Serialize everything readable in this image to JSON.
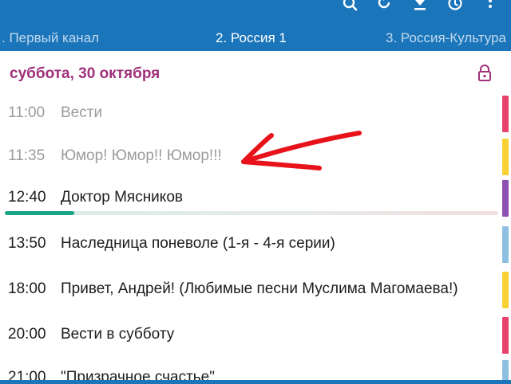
{
  "toolbar": {
    "icons": [
      "search-icon",
      "refresh-icon",
      "download-icon",
      "clock-icon",
      "more-vert-icon"
    ]
  },
  "tabs": [
    {
      "label": ". Первый канал"
    },
    {
      "label": "2. Россия 1"
    },
    {
      "label": "3. Россия-Культура"
    }
  ],
  "active_tab_index": 1,
  "schedule": {
    "date": "суббота, 30 октября",
    "lock_icon": "lock-icon",
    "now_progress": 0.14,
    "programs": [
      {
        "time": "11:00",
        "title": "Вести",
        "status": "past",
        "genre_color": "#e8436b"
      },
      {
        "time": "11:35",
        "title": "Юмор! Юмор!! Юмор!!!",
        "status": "past",
        "genre_color": "#f8d232"
      },
      {
        "time": "12:40",
        "title": "Доктор Мясников",
        "status": "now",
        "genre_color": "#8e4fb3"
      },
      {
        "time": "13:50",
        "title": "Наследница поневоле (1-я - 4-я серии)",
        "status": "future",
        "genre_color": "#8fbfe0"
      },
      {
        "time": "18:00",
        "title": "Привет, Андрей! (Любимые песни Муслима Магомаева!)",
        "status": "future",
        "genre_color": "#f8d232"
      },
      {
        "time": "20:00",
        "title": "Вести в субботу",
        "status": "future",
        "genre_color": "#e8436b"
      },
      {
        "time": "21:00",
        "title": "\"Призрачное счастье\".",
        "status": "future",
        "genre_color": "#8fbfe0"
      }
    ]
  },
  "colors": {
    "appbar": "#1b75bb",
    "date_text": "#a0307a",
    "progress_fill": "#1aa48a",
    "annotation_arrow": "#e8131a"
  }
}
